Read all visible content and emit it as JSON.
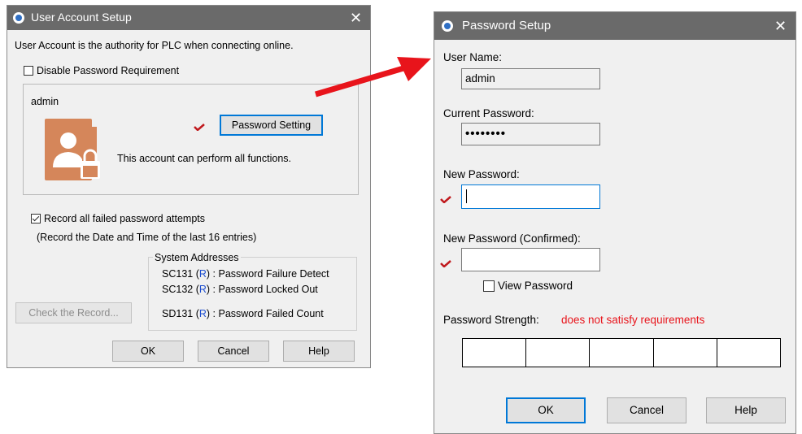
{
  "user_account_setup": {
    "title": "User Account Setup",
    "description": "User Account is the authority for PLC when connecting online.",
    "disable_password_label": "Disable Password Requirement",
    "disable_password_checked": false,
    "account_name": "admin",
    "password_setting_button": "Password Setting",
    "account_description": "This account can perform all functions.",
    "record_failed_label": "Record all failed password attempts",
    "record_failed_checked": true,
    "record_failed_note": "(Record the Date and Time of the last 16 entries)",
    "system_addresses": {
      "legend": "System Addresses",
      "rows": [
        {
          "addr": "SC131",
          "flag": "R",
          "desc": ": Password Failure Detect"
        },
        {
          "addr": "SC132",
          "flag": "R",
          "desc": ": Password Locked Out"
        },
        {
          "addr": "SD131",
          "flag": "R",
          "desc": ": Password Failed Count"
        }
      ]
    },
    "check_record_button": "Check the Record...",
    "ok_button": "OK",
    "cancel_button": "Cancel",
    "help_button": "Help"
  },
  "password_setup": {
    "title": "Password Setup",
    "user_name_label": "User Name:",
    "user_name_value": "admin",
    "current_password_label": "Current Password:",
    "current_password_value": "••••••••",
    "new_password_label": "New Password:",
    "new_password_value": "",
    "new_password_confirmed_label": "New Password (Confirmed):",
    "new_password_confirmed_value": "",
    "view_password_label": "View Password",
    "view_password_checked": false,
    "strength_label": "Password Strength:",
    "strength_value": "does not satisfy requirements",
    "strength_segments": 5,
    "ok_button": "OK",
    "cancel_button": "Cancel",
    "help_button": "Help"
  },
  "colors": {
    "titlebar": "#6a6a6a",
    "checkmark_red": "#c0191d",
    "arrow_red": "#e8141b",
    "strength_text": "#e8141b",
    "register_blue": "#1f4fd0",
    "focus_blue": "#0078d7"
  },
  "icons": [
    "app-icon",
    "close-icon",
    "user-lock-icon",
    "red-checkmark-icon",
    "red-arrow-icon"
  ]
}
